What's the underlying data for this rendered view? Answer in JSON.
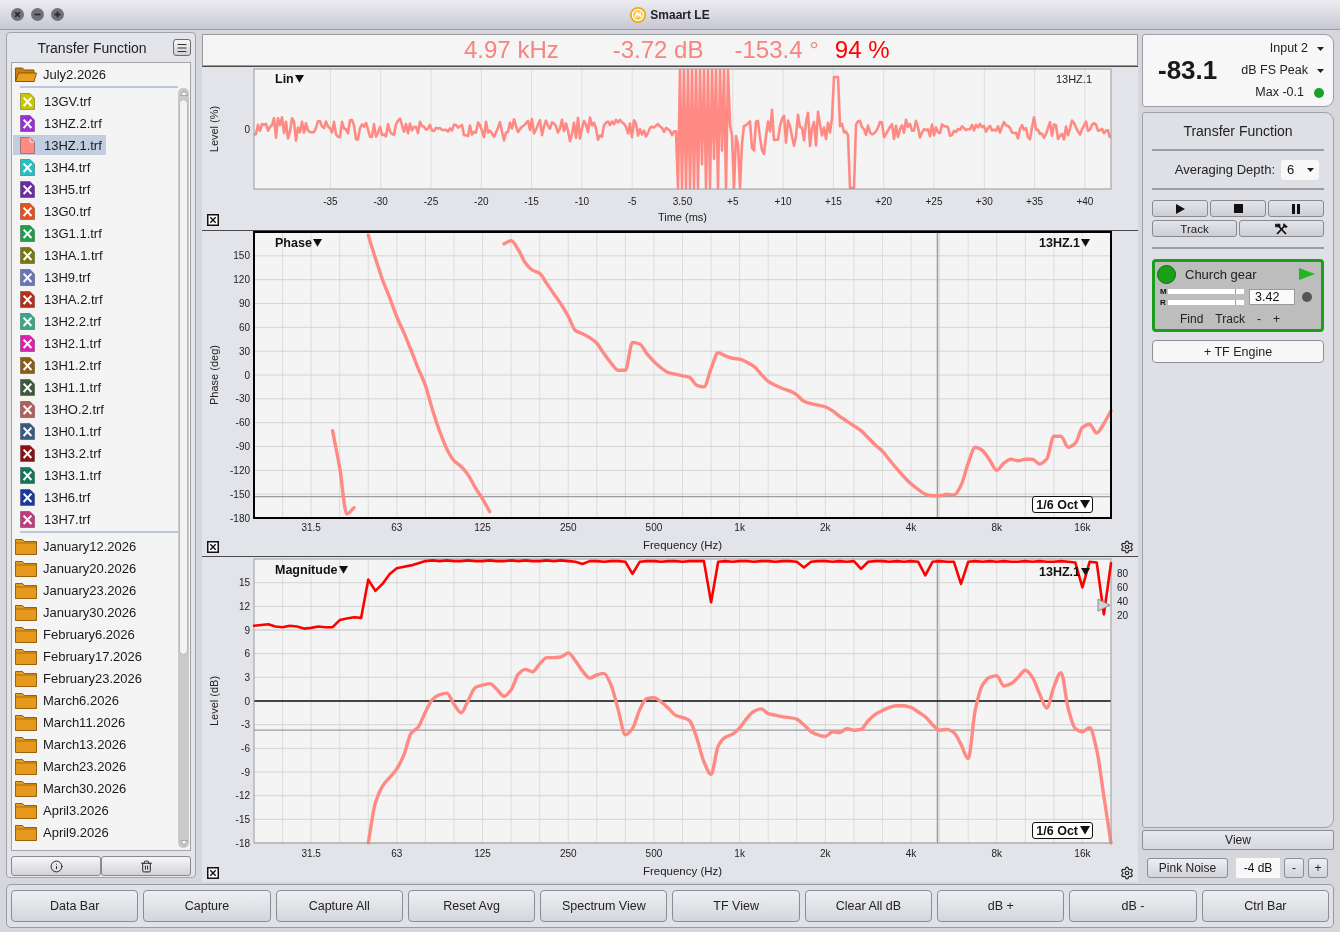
{
  "window": {
    "title": "Smaart LE"
  },
  "data_bar": {
    "title": "Transfer Function",
    "folders": [
      {
        "name": "July2.2026",
        "expanded": true,
        "selected": false,
        "children": [
          {
            "name": "13GV.trf",
            "color": "#c8c800",
            "shown": false,
            "selected": false
          },
          {
            "name": "13HZ.2.trf",
            "color": "#9a2fd6",
            "shown": false,
            "selected": false
          },
          {
            "name": "13HZ.1.trf",
            "color": "#ff8a84",
            "shown": true,
            "selected": true
          },
          {
            "name": "13H4.trf",
            "color": "#22c2c4",
            "shown": false,
            "selected": false
          },
          {
            "name": "13H5.trf",
            "color": "#6b2aa6",
            "shown": false,
            "selected": false
          },
          {
            "name": "13G0.trf",
            "color": "#e5501e",
            "shown": false,
            "selected": false
          },
          {
            "name": "13G1.1.trf",
            "color": "#1f9d4b",
            "shown": false,
            "selected": false
          },
          {
            "name": "13HA.1.trf",
            "color": "#78780f",
            "shown": false,
            "selected": false
          },
          {
            "name": "13H9.trf",
            "color": "#6676b6",
            "shown": false,
            "selected": false
          },
          {
            "name": "13HA.2.trf",
            "color": "#b4301c",
            "shown": false,
            "selected": false
          },
          {
            "name": "13H2.2.trf",
            "color": "#3aa888",
            "shown": false,
            "selected": false
          },
          {
            "name": "13H2.1.trf",
            "color": "#df1fb0",
            "shown": false,
            "selected": false
          },
          {
            "name": "13H1.2.trf",
            "color": "#8a5e12",
            "shown": false,
            "selected": false
          },
          {
            "name": "13H1.1.trf",
            "color": "#3c5a3c",
            "shown": false,
            "selected": false
          },
          {
            "name": "13HO.2.trf",
            "color": "#b45e5e",
            "shown": false,
            "selected": false
          },
          {
            "name": "13H0.1.trf",
            "color": "#3a5a82",
            "shown": false,
            "selected": false
          },
          {
            "name": "13H3.2.trf",
            "color": "#8a1212",
            "shown": false,
            "selected": false
          },
          {
            "name": "13H3.1.trf",
            "color": "#10785a",
            "shown": false,
            "selected": false
          },
          {
            "name": "13H6.trf",
            "color": "#1a3aa0",
            "shown": false,
            "selected": false
          },
          {
            "name": "13H7.trf",
            "color": "#c03a7e",
            "shown": false,
            "selected": false
          }
        ]
      },
      {
        "name": "January12.2026",
        "expanded": false,
        "selected": false
      },
      {
        "name": "January20.2026",
        "expanded": false,
        "selected": false
      },
      {
        "name": "January23.2026",
        "expanded": false,
        "selected": false
      },
      {
        "name": "January30.2026",
        "expanded": false,
        "selected": false
      },
      {
        "name": "February6.2026",
        "expanded": false,
        "selected": false
      },
      {
        "name": "February17.2026",
        "expanded": false,
        "selected": false
      },
      {
        "name": "February23.2026",
        "expanded": false,
        "selected": false
      },
      {
        "name": "March6.2026",
        "expanded": false,
        "selected": false
      },
      {
        "name": "March11.2026",
        "expanded": false,
        "selected": false
      },
      {
        "name": "March13.2026",
        "expanded": false,
        "selected": false
      },
      {
        "name": "March23.2026",
        "expanded": false,
        "selected": false
      },
      {
        "name": "March30.2026",
        "expanded": false,
        "selected": false
      },
      {
        "name": "April3.2026",
        "expanded": false,
        "selected": false
      },
      {
        "name": "April9.2026",
        "expanded": false,
        "selected": false
      }
    ]
  },
  "readouts": [
    {
      "text": "4.97 kHz",
      "color": "#f8847e"
    },
    {
      "text": "-3.72 dB",
      "color": "#f8847e"
    },
    {
      "text": "-153.4 °",
      "color": "#f8847e"
    },
    {
      "text": "94 %",
      "color": "#ff0000"
    }
  ],
  "impulse_panel": {
    "mode": "Lin",
    "trace": "13HZ.1",
    "ylabel": "Level (%)",
    "yticks": [
      "0"
    ],
    "xlabel": "Time (ms)",
    "xticks": [
      "-35",
      "-30",
      "-25",
      "-20",
      "-15",
      "-10",
      "-5",
      "3.50",
      "+5",
      "+10",
      "+15",
      "+20",
      "+25",
      "+30",
      "+35",
      "+40"
    ]
  },
  "phase_panel": {
    "active": true,
    "mode": "Phase",
    "smoothing": "1/6 Oct",
    "chart_data": {
      "type": "line",
      "xlabel": "Frequency (Hz)",
      "ylabel": "Phase (deg)",
      "grid": true,
      "ylim": [
        -180,
        180
      ],
      "yticks": [
        -180,
        -150,
        -120,
        -90,
        -60,
        -30,
        0,
        30,
        60,
        90,
        120,
        150
      ],
      "categories": [
        null,
        null,
        null,
        null,
        null,
        null,
        null,
        null,
        "31.5",
        null,
        null,
        null,
        null,
        null,
        null,
        null,
        null,
        null,
        null,
        null,
        "63",
        null,
        null,
        null,
        null,
        null,
        null,
        null,
        null,
        null,
        null,
        null,
        "125",
        null,
        null,
        null,
        null,
        null,
        null,
        null,
        null,
        null,
        null,
        null,
        "250",
        null,
        null,
        null,
        null,
        null,
        null,
        null,
        null,
        null,
        null,
        null,
        "500",
        null,
        null,
        null,
        null,
        null,
        null,
        null,
        null,
        null,
        null,
        null,
        "1k",
        null,
        null,
        null,
        null,
        null,
        null,
        null,
        null,
        null,
        null,
        null,
        "2k",
        null,
        null,
        null,
        null,
        null,
        null,
        null,
        null,
        null,
        null,
        null,
        "4k",
        null,
        null,
        null,
        null,
        null,
        null,
        null,
        null,
        null,
        null,
        null,
        "8k",
        null,
        null,
        null,
        null,
        null,
        null,
        null,
        null,
        null,
        null,
        null,
        "16k",
        null,
        null,
        null,
        null
      ],
      "series": [
        {
          "name": "13HZ.1",
          "color": "#ff8a84",
          "values": [
            null,
            null,
            null,
            null,
            null,
            null,
            null,
            null,
            null,
            null,
            null,
            -70,
            -117,
            -175,
            -167,
            null,
            176,
            147,
            120,
            97,
            73,
            53,
            31,
            8,
            -13,
            -44,
            -71,
            -93,
            -108,
            -115,
            -126,
            -142,
            -156,
            -172,
            null,
            165,
            169,
            158,
            141,
            132,
            128,
            115,
            102,
            89,
            74,
            56,
            52,
            47,
            40,
            27,
            15,
            6,
            6,
            41,
            39,
            27,
            17,
            9,
            3,
            1,
            -1,
            -3,
            -13,
            -15,
            8,
            28,
            24,
            21,
            20,
            16,
            11,
            1,
            -8,
            -13,
            -17,
            -20,
            -25,
            -33,
            -36,
            -38,
            -40,
            -45,
            -52,
            -58,
            -64,
            -70,
            -79,
            -88,
            -96,
            -107,
            -118,
            -128,
            -137,
            -144,
            -150,
            -152,
            -152,
            -150,
            -151,
            -139,
            -111,
            -91,
            -95,
            -107,
            -120,
            -111,
            -106,
            -108,
            -106,
            -106,
            -112,
            -106,
            -77,
            -77,
            -91,
            -86,
            -66,
            -62,
            -73,
            -61,
            -45
          ]
        }
      ],
      "ref_lines": [
        {
          "axis": "y",
          "value": -153,
          "color": "#9c9c9c"
        }
      ]
    }
  },
  "magnitude_panel": {
    "active": false,
    "mode": "Magnitude",
    "smoothing": "1/6 Oct",
    "chart_data": {
      "type": "line",
      "xlabel": "Frequency (Hz)",
      "ylabel": "Level (dB)",
      "grid": true,
      "ylim": [
        -18,
        18
      ],
      "yticks": [
        -18,
        -15,
        -12,
        -9,
        -6,
        -3,
        0,
        3,
        6,
        9,
        12,
        15
      ],
      "categories": [
        null,
        null,
        null,
        null,
        null,
        null,
        null,
        null,
        "31.5",
        null,
        null,
        null,
        null,
        null,
        null,
        null,
        null,
        null,
        null,
        null,
        "63",
        null,
        null,
        null,
        null,
        null,
        null,
        null,
        null,
        null,
        null,
        null,
        "125",
        null,
        null,
        null,
        null,
        null,
        null,
        null,
        null,
        null,
        null,
        null,
        "250",
        null,
        null,
        null,
        null,
        null,
        null,
        null,
        null,
        null,
        null,
        null,
        "500",
        null,
        null,
        null,
        null,
        null,
        null,
        null,
        null,
        null,
        null,
        null,
        "1k",
        null,
        null,
        null,
        null,
        null,
        null,
        null,
        null,
        null,
        null,
        null,
        "2k",
        null,
        null,
        null,
        null,
        null,
        null,
        null,
        null,
        null,
        null,
        null,
        "4k",
        null,
        null,
        null,
        null,
        null,
        null,
        null,
        null,
        null,
        null,
        null,
        "8k",
        null,
        null,
        null,
        null,
        null,
        null,
        null,
        null,
        null,
        null,
        null,
        "16k",
        null,
        null,
        null,
        null
      ],
      "series": [
        {
          "name": "13HZ.1",
          "color": "#ff8a84",
          "values": [
            null,
            null,
            null,
            null,
            null,
            null,
            null,
            null,
            null,
            null,
            null,
            null,
            null,
            null,
            null,
            null,
            -18,
            -12.9,
            -10.8,
            -9.7,
            -8.6,
            -6.8,
            -4.1,
            -3.3,
            -1.4,
            0.2,
            0.8,
            1,
            -0.4,
            -1.5,
            0.1,
            1.7,
            2,
            2.2,
            1.5,
            0.6,
            1.4,
            3.4,
            4,
            3.7,
            4.7,
            5.5,
            5.5,
            5.6,
            6.1,
            5.1,
            3.8,
            2.9,
            3.3,
            3.5,
            2,
            -1.1,
            -4.3,
            -3.5,
            -1.1,
            0.3,
            0.4,
            -0.1,
            -0.9,
            -1.8,
            -2.1,
            -2.5,
            -4.7,
            -7.7,
            -9.3,
            -5.7,
            -4.6,
            -4.2,
            -3.4,
            -2.2,
            -1.3,
            -1,
            -1.6,
            -1.8,
            -2,
            -2.1,
            -2.3,
            -3,
            -3.9,
            -4.3,
            -4.5,
            -3.9,
            -4,
            -3.5,
            -3.7,
            -3.6,
            -2.5,
            -1.7,
            -1.2,
            -0.8,
            -0.6,
            -0.6,
            -0.8,
            -1.4,
            -2,
            -3,
            -3.7,
            -3.6,
            -4,
            -5.5,
            -7.3,
            -1.1,
            2,
            3,
            3.2,
            1.9,
            2.2,
            3,
            3.9,
            3,
            0.9,
            -0.9,
            1.8,
            3.6,
            -0.9,
            -3.5,
            -3.9,
            -3.4,
            -6.2,
            -12.1,
            -18
          ]
        }
      ],
      "ref_lines": [
        {
          "axis": "y",
          "value": 0,
          "color": "#111111"
        },
        {
          "axis": "y",
          "value": -3.7,
          "color": "#9c9c9c"
        }
      ]
    },
    "coherence": {
      "chart_data": {
        "type": "line",
        "ylim": [
          0,
          100
        ],
        "yticks": [
          20,
          40,
          60,
          80
        ],
        "categories": [
          null,
          null,
          null,
          null,
          null,
          null,
          null,
          null,
          null,
          null,
          null,
          null,
          null,
          null,
          null,
          null,
          null,
          null,
          null,
          null,
          null,
          null,
          null,
          null,
          null,
          null,
          null,
          null,
          null,
          null,
          null,
          null,
          null,
          null,
          null,
          null,
          null,
          null,
          null,
          null,
          null,
          null,
          null,
          null,
          null,
          null,
          null,
          null,
          null,
          null,
          null,
          null,
          null,
          null,
          null,
          null,
          null,
          null,
          null,
          null,
          null,
          null,
          null,
          null,
          null,
          null,
          null,
          null,
          null,
          null,
          null,
          null,
          null,
          null,
          null,
          null,
          null,
          null,
          null,
          null,
          null,
          null,
          null,
          null,
          null,
          null,
          null,
          null,
          null,
          null,
          null,
          null,
          null,
          null,
          null,
          null,
          null,
          null,
          null,
          null,
          null,
          null,
          null,
          null,
          null,
          null,
          null,
          null,
          null,
          null,
          null,
          null,
          null,
          null,
          null,
          null,
          null,
          null,
          null,
          null,
          null
        ],
        "series": [
          {
            "color": "#ff0000",
            "values": [
              6,
              7,
              8,
              5,
              4,
              6,
              5,
              2,
              3,
              5,
              4,
              4,
              14,
              16,
              18,
              17,
              71,
              55,
              65,
              79,
              87,
              89,
              91,
              94,
              97,
              98,
              97,
              98,
              97,
              97,
              98,
              97,
              97,
              98,
              97,
              97,
              98,
              97,
              98,
              97,
              97,
              98,
              97,
              98,
              97,
              96,
              93,
              97,
              97,
              96,
              97,
              97,
              96,
              79,
              96,
              97,
              97,
              96,
              97,
              97,
              96,
              97,
              97,
              97,
              39,
              96,
              97,
              96,
              97,
              97,
              96,
              97,
              97,
              96,
              97,
              97,
              96,
              88,
              96,
              97,
              97,
              96,
              97,
              96,
              97,
              86,
              96,
              97,
              97,
              96,
              97,
              96,
              97,
              96,
              77,
              96,
              97,
              96,
              96,
              65,
              96,
              97,
              96,
              97,
              96,
              97,
              96,
              96,
              97,
              96,
              97,
              96,
              96,
              97,
              96,
              95,
              60,
              96,
              95,
              22,
              94
            ]
          }
        ]
      }
    }
  },
  "meter": {
    "value": "-83.1",
    "input": "Input 2",
    "unit": "dB FS Peak",
    "max": "Max -0.1",
    "clip": false
  },
  "control_panel": {
    "title": "Transfer Function",
    "averaging_label": "Averaging Depth:",
    "averaging_value": "6",
    "track_button": "Track",
    "engine": {
      "name": "Church gear",
      "running": true,
      "meters": [
        "M",
        "R"
      ],
      "delay": "3.42",
      "actions": [
        "Find",
        "Track",
        "-",
        "+"
      ]
    },
    "add_engine": "+ TF Engine"
  },
  "view_button": "View",
  "generator": {
    "button": "Pink Noise",
    "gain": "-4 dB",
    "steps": [
      "-",
      "+"
    ]
  },
  "bottom_buttons": [
    "Data Bar",
    "Capture",
    "Capture All",
    "Reset Avg",
    "Spectrum View",
    "TF View",
    "Clear All dB",
    "dB +",
    "dB -",
    "Ctrl Bar"
  ]
}
